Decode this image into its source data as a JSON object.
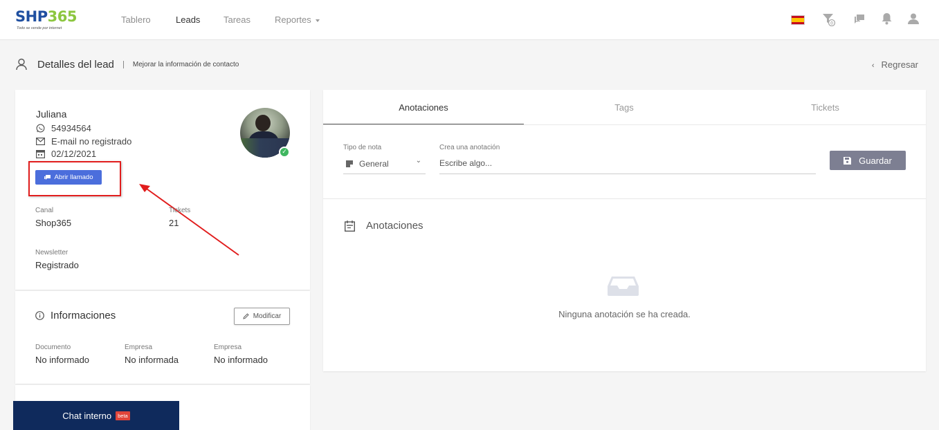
{
  "brand": {
    "name_a": "SH",
    "name_b": "P",
    "name_c": "365",
    "tagline": "Todo se vende por internet"
  },
  "nav": {
    "items": [
      "Tablero",
      "Leads",
      "Tareas",
      "Reportes"
    ],
    "active": "Leads"
  },
  "header": {
    "title": "Detalles del lead",
    "subtitle": "Mejorar la información de contacto",
    "back_label": "Regresar"
  },
  "lead": {
    "name": "Juliana",
    "phone": "54934564",
    "email": "E-mail no registrado",
    "date": "02/12/2021",
    "call_button": "Abrir llamado",
    "canal_label": "Canal",
    "canal_value": "Shop365",
    "tickets_label": "Tickets",
    "tickets_value": "21",
    "newsletter_label": "Newsletter",
    "newsletter_value": "Registrado"
  },
  "informaciones": {
    "title": "Informaciones",
    "edit_button": "Modificar",
    "fields": [
      {
        "label": "Documento",
        "value": "No informado"
      },
      {
        "label": "Empresa",
        "value": "No informada"
      },
      {
        "label": "Empresa",
        "value": "No informado"
      }
    ]
  },
  "tabs": [
    "Anotaciones",
    "Tags",
    "Tickets"
  ],
  "note_form": {
    "type_label": "Tipo de nota",
    "type_value": "General",
    "note_label": "Crea una anotación",
    "note_placeholder": "Escribe algo...",
    "save_button": "Guardar"
  },
  "annotations": {
    "title": "Anotaciones",
    "empty_text": "Ninguna anotación se ha creada."
  },
  "chat": {
    "label": "Chat interno",
    "badge": "beta"
  },
  "colors": {
    "primary": "#4b6edc",
    "logo_blue": "#1f4fa0",
    "logo_green": "#8cc63f",
    "chat_bg": "#0f2a5c",
    "highlight": "#e11d1d",
    "online": "#3fb660"
  }
}
